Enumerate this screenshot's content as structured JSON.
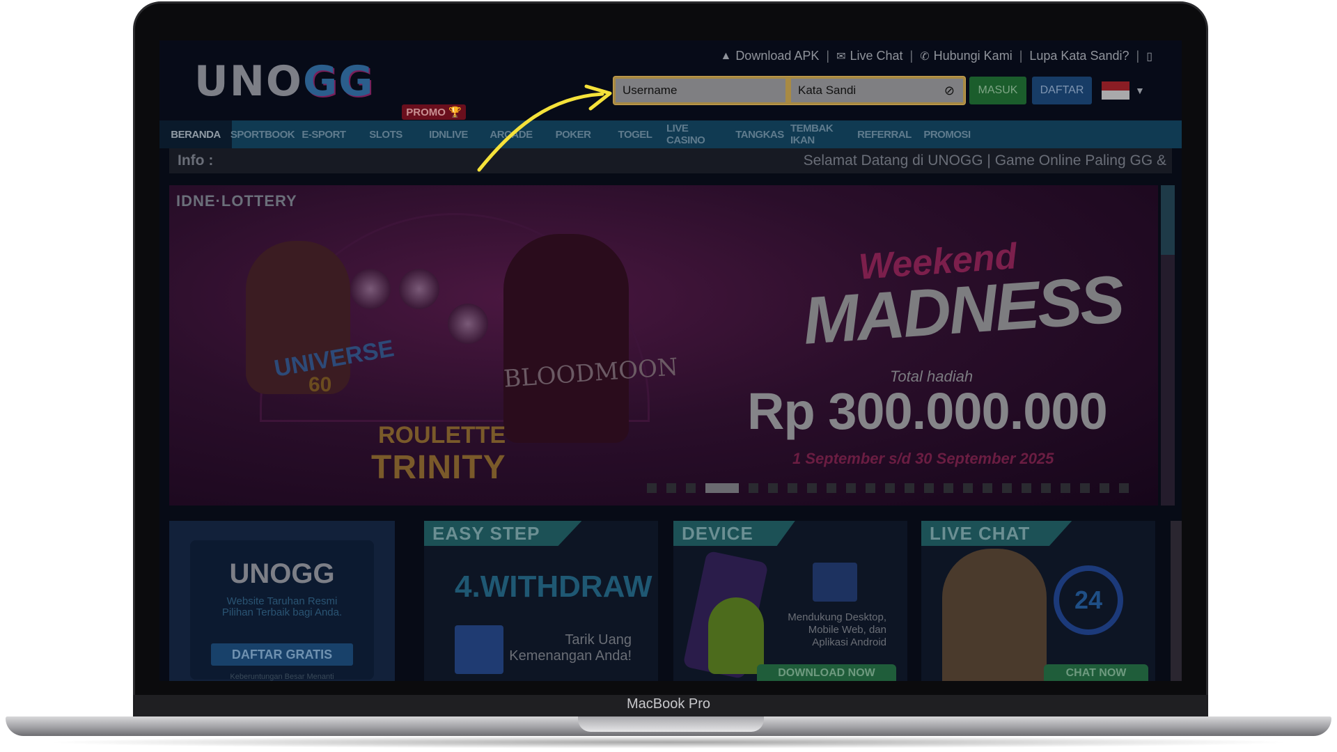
{
  "device": {
    "label": "MacBook Pro"
  },
  "site": {
    "logo": {
      "main": "UNO",
      "accent": "GG"
    },
    "toplinks": [
      {
        "icon": "android-icon",
        "glyph": "▲",
        "label": "Download APK"
      },
      {
        "icon": "chat-icon",
        "glyph": "✉",
        "label": "Live Chat"
      },
      {
        "icon": "phone-icon",
        "glyph": "✆",
        "label": "Hubungi Kami"
      },
      {
        "icon": "",
        "glyph": "",
        "label": "Lupa Kata Sandi?"
      }
    ],
    "mobile_icon": "▯",
    "login": {
      "username_placeholder": "Username",
      "password_placeholder": "Kata Sandi",
      "eye_glyph": "⊘",
      "masuk": "MASUK",
      "daftar": "DAFTAR",
      "caret": "▼"
    },
    "promo_tag": "PROMO 🏆",
    "nav": [
      "BERANDA",
      "SPORTBOOK",
      "E-SPORT",
      "SLOTS",
      "IDNLIVE",
      "ARCADE",
      "POKER",
      "TOGEL",
      "LIVE CASINO",
      "TANGKAS",
      "TEMBAK IKAN",
      "REFERRAL",
      "PROMOSI"
    ],
    "info": {
      "label": "Info :",
      "message": "Selamat Datang di UNOGG | Game Online Paling GG &"
    },
    "banner": {
      "brand": "IDNE·LOTTERY",
      "game1": "UNIVERSE",
      "game1_num": "60",
      "game2": "BLOODMOON",
      "game3_line1": "ROULETTE",
      "game3_line2": "TRINITY",
      "headline1": "Weekend",
      "headline2": "MADNESS",
      "total_label": "Total hadiah",
      "prize": "Rp 300.000.000",
      "period": "1 September s/d 30 September 2025",
      "slide_count": 24,
      "active_slide": 4
    },
    "cards": {
      "logo_card": {
        "logo": "UNOGG",
        "tagline1": "Website Taruhan Resmi",
        "tagline2": "Pilihan Terbaik bagi Anda.",
        "button": "DAFTAR GRATIS",
        "footer": "Keberuntungan Besar Menanti"
      },
      "easy_step": {
        "tab": "EASY STEP",
        "step": "4.WITHDRAW",
        "line1": "Tarik Uang",
        "line2": "Kemenangan Anda!"
      },
      "device": {
        "tab": "DEVICE",
        "line1": "Mendukung Desktop,",
        "line2": "Mobile Web, dan",
        "line3": "Aplikasi Android",
        "button": "DOWNLOAD NOW"
      },
      "live_chat": {
        "tab": "LIVE CHAT",
        "hours": "24",
        "button": "CHAT NOW"
      }
    }
  },
  "colors": {
    "arrow": "#f5e23a",
    "highlight_border": "#c9a24f"
  }
}
